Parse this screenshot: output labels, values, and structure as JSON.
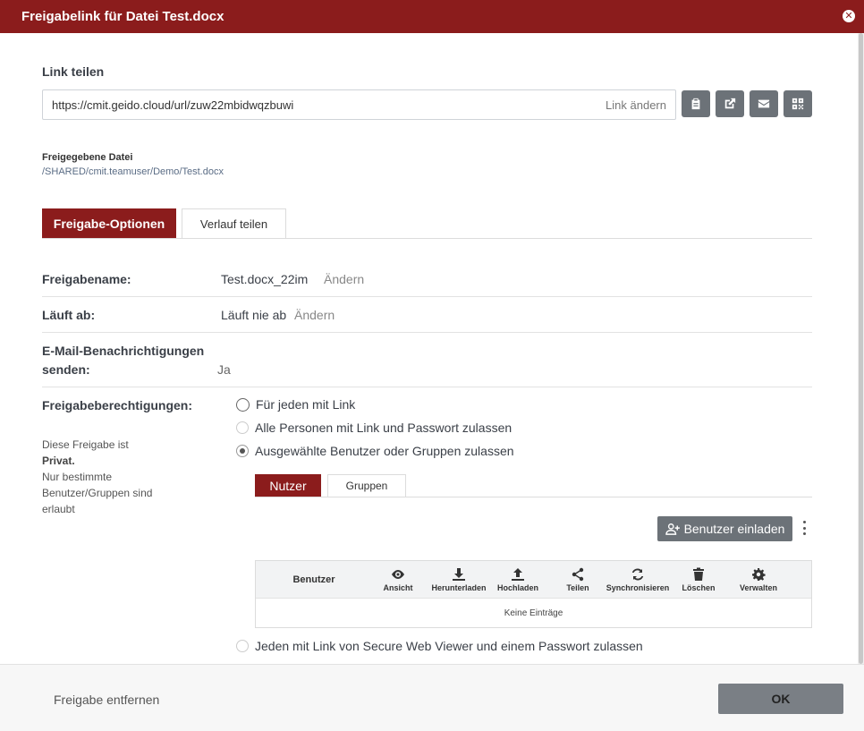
{
  "window": {
    "title": "Freigabelink für Datei Test.docx"
  },
  "share_link": {
    "section_label": "Link teilen",
    "url": "https://cmit.geido.cloud/url/zuw22mbidwqzbuwi",
    "change_label": "Link ändern",
    "actions": [
      {
        "name": "copy-button",
        "icon": "clipboard-icon"
      },
      {
        "name": "open-link-button",
        "icon": "external-link-icon"
      },
      {
        "name": "email-button",
        "icon": "envelope-icon"
      },
      {
        "name": "qr-code-button",
        "icon": "qr-code-icon"
      }
    ]
  },
  "shared_file": {
    "label": "Freigegebene Datei",
    "path": "/SHARED/cmit.teamuser/Demo/Test.docx"
  },
  "tabs": [
    {
      "label": "Freigabe-Optionen",
      "active": true
    },
    {
      "label": "Verlauf teilen",
      "active": false
    }
  ],
  "options": {
    "share_name": {
      "label": "Freigabename:",
      "value": "Test.docx_22im",
      "change": "Ändern"
    },
    "expires": {
      "label": "Läuft ab:",
      "value": "Läuft nie ab",
      "change": "Ändern"
    },
    "email": {
      "label_line1": "E-Mail-Benachrichtigungen",
      "label_line2": "senden:",
      "value": "Ja"
    },
    "permissions": {
      "label": "Freigabeberechtigungen:",
      "note": {
        "line1": "Diese Freigabe ist",
        "line2": "Privat.",
        "line3": "Nur bestimmte",
        "line4": "Benutzer/Gruppen sind",
        "line5": "erlaubt"
      },
      "choices": [
        {
          "label": "Für jeden mit Link",
          "selected": false
        },
        {
          "label": "Alle Personen mit Link und Passwort zulassen",
          "selected": false
        },
        {
          "label": "Ausgewählte Benutzer oder Gruppen zulassen",
          "selected": true
        },
        {
          "label": "Jeden mit Link von Secure Web Viewer und einem Passwort zulassen",
          "selected": false
        }
      ]
    }
  },
  "user_groups": {
    "tabs": [
      {
        "label": "Nutzer",
        "active": true
      },
      {
        "label": "Gruppen",
        "active": false
      }
    ],
    "invite_label": "Benutzer einladen",
    "columns": {
      "user": "Benutzer",
      "view": "Ansicht",
      "download": "Herunterladen",
      "upload": "Hochladen",
      "share": "Teilen",
      "sync": "Synchronisieren",
      "delete": "Löschen",
      "manage": "Verwalten"
    },
    "empty_text": "Keine Einträge"
  },
  "footer": {
    "remove_label": "Freigabe entfernen",
    "ok_label": "OK"
  },
  "colors": {
    "brand": "#8b1c1c",
    "button_gray": "#6c7278"
  }
}
